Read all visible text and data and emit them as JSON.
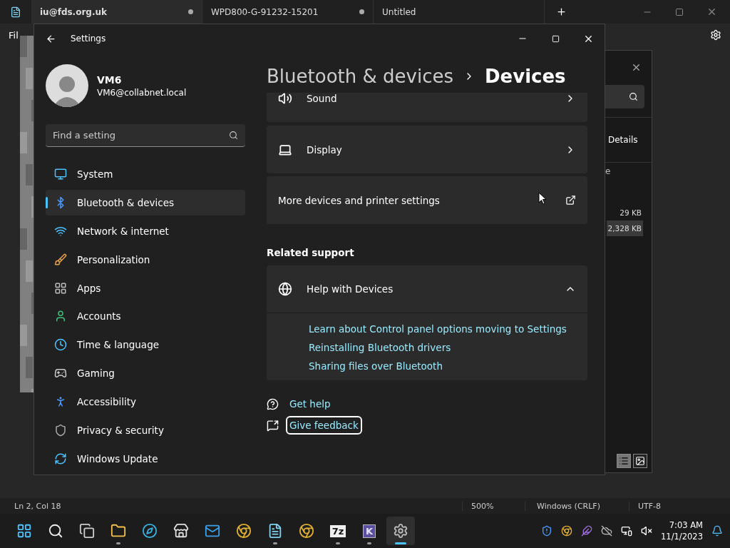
{
  "notepad": {
    "tabs": [
      {
        "label": "iu@fds.org.uk",
        "selected": true,
        "modified": true
      },
      {
        "label": "WPD800-G-91232-15201",
        "selected": false,
        "modified": true
      },
      {
        "label": "Untitled",
        "selected": false,
        "modified": false
      }
    ],
    "menu": [
      "Fil"
    ],
    "status_bar": [
      "Ln 2, Col 18",
      "500%",
      "Windows (CRLF)",
      "UTF-8"
    ]
  },
  "explorer": {
    "view_label": "Details",
    "column_partial": "e",
    "rows": [
      {
        "size": "29 KB",
        "selected": false
      },
      {
        "size": "2,328 KB",
        "selected": true
      }
    ]
  },
  "settings": {
    "title": "Settings",
    "user": {
      "name": "VM6",
      "email": "VM6@collabnet.local"
    },
    "search": {
      "placeholder": "Find a setting"
    },
    "nav": [
      {
        "label": "System",
        "kind": "system",
        "selected": false
      },
      {
        "label": "Bluetooth & devices",
        "kind": "bluetooth",
        "selected": true
      },
      {
        "label": "Network & internet",
        "kind": "network",
        "selected": false
      },
      {
        "label": "Personalization",
        "kind": "brush",
        "selected": false
      },
      {
        "label": "Apps",
        "kind": "apps",
        "selected": false
      },
      {
        "label": "Accounts",
        "kind": "accounts",
        "selected": false
      },
      {
        "label": "Time & language",
        "kind": "time",
        "selected": false
      },
      {
        "label": "Gaming",
        "kind": "gaming",
        "selected": false
      },
      {
        "label": "Accessibility",
        "kind": "accessibility",
        "selected": false
      },
      {
        "label": "Privacy & security",
        "kind": "privacy",
        "selected": false
      },
      {
        "label": "Windows Update",
        "kind": "update",
        "selected": false
      }
    ],
    "breadcrumb": [
      "Bluetooth & devices",
      "Devices"
    ],
    "cards": [
      {
        "kind": "sound",
        "label": "Sound"
      },
      {
        "kind": "display",
        "label": "Display"
      },
      {
        "kind": "external",
        "label": "More devices and printer settings"
      }
    ],
    "related": {
      "heading": "Related support",
      "card": {
        "label": "Help with Devices",
        "expanded": true,
        "links": [
          "Learn about Control panel options moving to Settings",
          "Reinstalling Bluetooth drivers",
          "Sharing files over Bluetooth"
        ]
      }
    },
    "footer": [
      {
        "kind": "help",
        "label": "Get help",
        "focused": false
      },
      {
        "kind": "feedback",
        "label": "Give feedback",
        "focused": true
      }
    ]
  },
  "taskbar": {
    "apps": [
      {
        "kind": "start",
        "running": false,
        "active": false
      },
      {
        "kind": "search",
        "running": false,
        "active": false
      },
      {
        "kind": "taskview",
        "running": false,
        "active": false
      },
      {
        "kind": "folder",
        "running": true,
        "active": false
      },
      {
        "kind": "edge",
        "running": false,
        "active": false
      },
      {
        "kind": "store",
        "running": false,
        "active": false
      },
      {
        "kind": "mail",
        "running": false,
        "active": false
      },
      {
        "kind": "chrome",
        "running": false,
        "active": false
      },
      {
        "kind": "notepad",
        "running": true,
        "active": false
      },
      {
        "kind": "chrome",
        "running": false,
        "active": false
      },
      {
        "kind": "label",
        "label": "7z",
        "running": true,
        "active": false
      },
      {
        "kind": "k",
        "label": "K",
        "running": true,
        "active": false
      },
      {
        "kind": "settings",
        "running": true,
        "active": true
      }
    ],
    "time": "7:03 AM",
    "date": "11/1/2023"
  }
}
